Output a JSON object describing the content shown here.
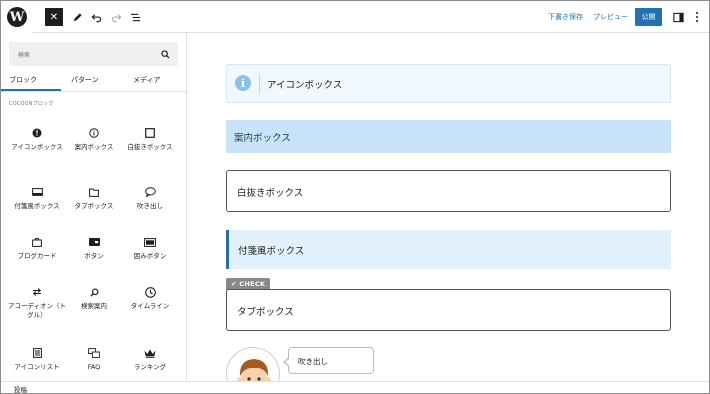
{
  "toolbar": {
    "draft_label": "下書き保存",
    "preview_label": "プレビュー",
    "publish_label": "公開"
  },
  "sidebar": {
    "search_placeholder": "検索",
    "tabs": [
      "ブロック",
      "パターン",
      "メディア"
    ],
    "category": "COCOONブロック",
    "blocks": [
      {
        "label": "アイコンボックス",
        "icon": "exclamation-circle-icon"
      },
      {
        "label": "案内ボックス",
        "icon": "info-circle-icon"
      },
      {
        "label": "白抜きボックス",
        "icon": "square-icon"
      },
      {
        "label": "付箋風ボックス",
        "icon": "sticky-note-icon"
      },
      {
        "label": "タブボックス",
        "icon": "folder-icon"
      },
      {
        "label": "吹き出し",
        "icon": "speech-bubble-icon"
      },
      {
        "label": "ブログカード",
        "icon": "card-icon"
      },
      {
        "label": "ボタン",
        "icon": "button-icon"
      },
      {
        "label": "囲みボタン",
        "icon": "wrapped-button-icon"
      },
      {
        "label": "アコーディオン（トグル）",
        "icon": "toggle-arrows-icon"
      },
      {
        "label": "検索案内",
        "icon": "magnifier-icon"
      },
      {
        "label": "タイムライン",
        "icon": "clock-icon"
      },
      {
        "label": "アイコンリスト",
        "icon": "icon-list-icon"
      },
      {
        "label": "FAQ",
        "icon": "faq-icon"
      },
      {
        "label": "ランキング",
        "icon": "crown-icon"
      }
    ]
  },
  "canvas": {
    "icon_box_text": "アイコンボックス",
    "info_box_text": "案内ボックス",
    "white_box_text": "白抜きボックス",
    "sticky_box_text": "付箋風ボックス",
    "tab_label": "✔ CHECK",
    "tab_box_text": "タブボックス",
    "balloon_text": "吹き出し"
  },
  "footer": {
    "breadcrumb": "投稿"
  },
  "colors": {
    "accent": "#2271b1",
    "info_box_bg": "#c8e2fa",
    "sticky_bg": "#e3f1fc",
    "icon_box_bg": "#f1f8fd"
  }
}
